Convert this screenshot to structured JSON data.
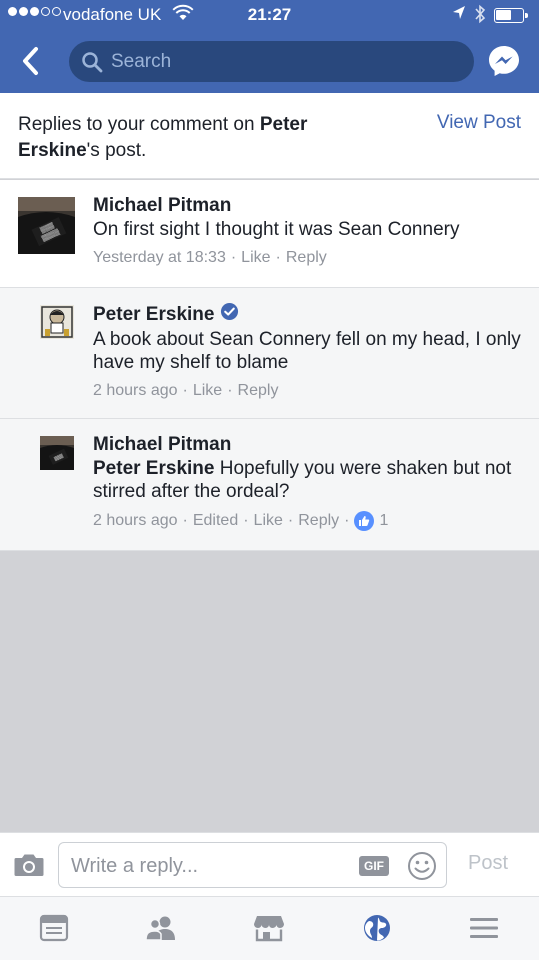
{
  "status_bar": {
    "carrier": "vodafone UK",
    "time": "21:27"
  },
  "nav": {
    "search_placeholder": "Search"
  },
  "header": {
    "prefix": "Replies to your comment on ",
    "author": "Peter Erskine",
    "suffix": "'s post.",
    "view_post": "View Post"
  },
  "comments": [
    {
      "author": "Michael Pitman",
      "text": "On first sight I thought it was Sean Connery",
      "time": "Yesterday at 18:33",
      "like": "Like",
      "reply": "Reply"
    },
    {
      "author": "Peter Erskine",
      "verified": true,
      "text": "A book about Sean  Connery fell on my head, I only have my shelf to blame",
      "time": "2 hours ago",
      "like": "Like",
      "reply": "Reply"
    },
    {
      "author": "Michael Pitman",
      "mention": "Peter Erskine",
      "text": " Hopefully you were shaken but not stirred after the ordeal?",
      "time": "2 hours ago",
      "edited": "Edited",
      "like": "Like",
      "reply": "Reply",
      "like_count": "1"
    }
  ],
  "meta_separator": "·",
  "reply_bar": {
    "placeholder": "Write a reply...",
    "gif_label": "GIF",
    "post_label": "Post"
  },
  "tabs": [
    {
      "icon": "news-feed-icon"
    },
    {
      "icon": "friends-icon"
    },
    {
      "icon": "marketplace-icon"
    },
    {
      "icon": "notifications-globe-icon",
      "active": true
    },
    {
      "icon": "menu-icon"
    }
  ],
  "colors": {
    "brand": "#4267b2",
    "search_bg": "#29487d",
    "link": "#4267b2",
    "meta": "#90949c",
    "like_blue": "#5890ff",
    "empty_area": "#d1d2d6"
  }
}
